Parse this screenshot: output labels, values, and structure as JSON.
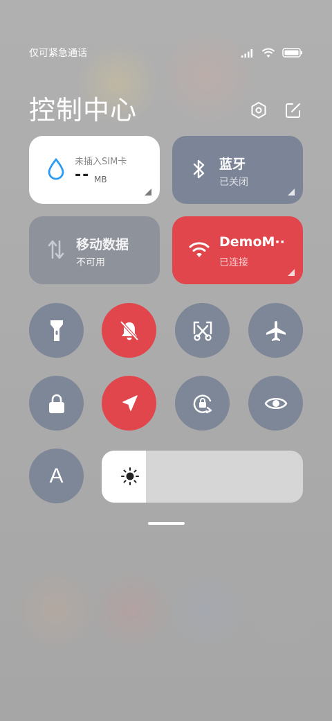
{
  "status": {
    "carrier_text": "仅可紧急通话"
  },
  "header": {
    "title": "控制中心"
  },
  "tiles": {
    "data": {
      "label": "未插入SIM卡",
      "value": "--",
      "unit": "MB"
    },
    "bluetooth": {
      "title": "蓝牙",
      "subtitle": "已关闭"
    },
    "mobile": {
      "title": "移动数据",
      "subtitle": "不可用"
    },
    "wifi": {
      "title": "DemoM··",
      "subtitle": "已连接"
    }
  },
  "toggles": [
    {
      "icon": "flashlight-icon",
      "state": "off"
    },
    {
      "icon": "mute-bell-icon",
      "state": "on"
    },
    {
      "icon": "screenshot-icon",
      "state": "off"
    },
    {
      "icon": "airplane-icon",
      "state": "off"
    },
    {
      "icon": "lock-icon",
      "state": "off"
    },
    {
      "icon": "location-icon",
      "state": "on"
    },
    {
      "icon": "rotation-lock-icon",
      "state": "off"
    },
    {
      "icon": "reading-mode-icon",
      "state": "off"
    },
    {
      "icon": "auto-brightness-letter",
      "label": "A",
      "state": "off"
    }
  ],
  "brightness": {
    "level_percent": 22
  },
  "colors": {
    "accent_red": "#e0464b",
    "tile_grey": "#7e8797",
    "mobile_grey": "#8e929b",
    "bt_grey": "#7c8597",
    "slider_bg": "#d6d6d6"
  }
}
